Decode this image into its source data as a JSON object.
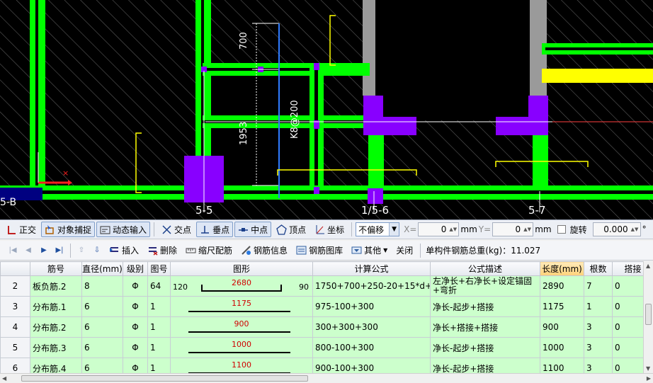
{
  "colors": {
    "wall": "#00ff00",
    "column": "#8800ff",
    "hatch": "#6a6a6a",
    "dim": "#ffff00",
    "axis": "#ffffff",
    "highlight_header": "#ffd27a",
    "row_bg": "#ccffcc",
    "shape_value": "#d00000"
  },
  "cad": {
    "dim_700": "700",
    "dim_1953": "1953",
    "rebar_label": "K8@200",
    "axis_label_left": "5-B",
    "axis_label_1": "5-5",
    "axis_label_2": "1/5-6",
    "axis_label_3": "5-7"
  },
  "snapbar": {
    "ortho": "正交",
    "object_snap": "对象捕捉",
    "dynamic_input": "动态输入",
    "intersection": "交点",
    "perpendicular": "垂点",
    "midpoint": "中点",
    "vertex": "顶点",
    "coordinate": "坐标",
    "offset_mode": "不偏移",
    "x_label": "X=",
    "x_value": "0",
    "x_unit": "mm",
    "y_label": "Y=",
    "y_value": "0",
    "y_unit": "mm",
    "rotate": "旋转",
    "rotate_value": "0.000",
    "degree": "°"
  },
  "tablebar": {
    "insert": "插入",
    "delete": "删除",
    "scale_rebar": "缩尺配筋",
    "rebar_info": "钢筋信息",
    "rebar_library": "钢筋图库",
    "other": "其他",
    "close": "关闭",
    "total_label": "单构件钢筋总重(kg)：11.027"
  },
  "table": {
    "headers": [
      "",
      "筋号",
      "直径(mm)",
      "级别",
      "图号",
      "图形",
      "计算公式",
      "公式描述",
      "长度(mm)",
      "根数",
      "搭接"
    ],
    "rows": [
      {
        "num": "2",
        "name": "板负筋.2",
        "dia": "8",
        "grade": "Φ",
        "fig": "64",
        "shape_val": "2680",
        "shape_left": "120",
        "shape_right": "90",
        "formula": "1750+700+250-20+15*d+90",
        "desc": "左净长+右净长+设定锚固+弯折",
        "length": "2890",
        "count": "7",
        "lap": "0"
      },
      {
        "num": "3",
        "name": "分布筋.1",
        "dia": "6",
        "grade": "Φ",
        "fig": "1",
        "shape_val": "1175",
        "shape_left": "",
        "shape_right": "",
        "formula": "975-100+300",
        "desc": "净长-起步+搭接",
        "length": "1175",
        "count": "1",
        "lap": "0"
      },
      {
        "num": "4",
        "name": "分布筋.2",
        "dia": "6",
        "grade": "Φ",
        "fig": "1",
        "shape_val": "900",
        "shape_left": "",
        "shape_right": "",
        "formula": "300+300+300",
        "desc": "净长+搭接+搭接",
        "length": "900",
        "count": "3",
        "lap": "0"
      },
      {
        "num": "5",
        "name": "分布筋.3",
        "dia": "6",
        "grade": "Φ",
        "fig": "1",
        "shape_val": "1000",
        "shape_left": "",
        "shape_right": "",
        "formula": "800-100+300",
        "desc": "净长-起步+搭接",
        "length": "1000",
        "count": "3",
        "lap": "0"
      },
      {
        "num": "6",
        "name": "分布筋.4",
        "dia": "6",
        "grade": "Φ",
        "fig": "1",
        "shape_val": "1100",
        "shape_left": "",
        "shape_right": "",
        "formula": "900-100+300",
        "desc": "净长-起步+搭接",
        "length": "1100",
        "count": "3",
        "lap": "0"
      }
    ]
  }
}
